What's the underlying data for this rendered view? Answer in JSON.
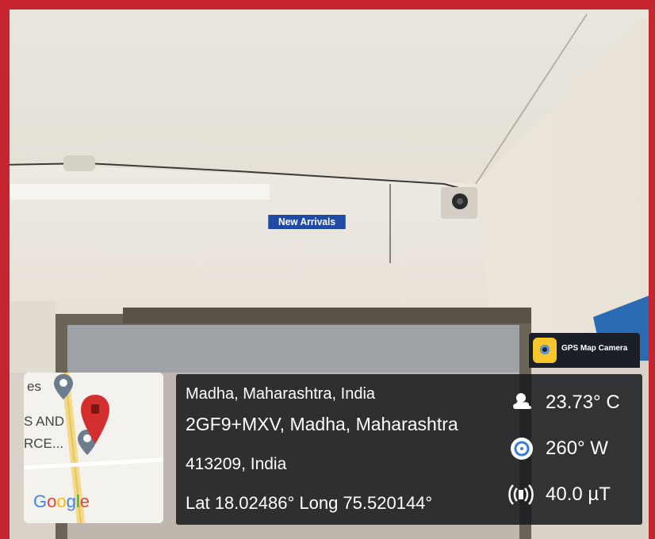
{
  "scene": {
    "sign_text": "New Arrivals"
  },
  "app_badge": {
    "label": "GPS Map Camera",
    "icon": "camera-pin-icon"
  },
  "map": {
    "labels": [
      "es",
      "S AND",
      "RCE..."
    ],
    "google_letters": [
      "G",
      "o",
      "o",
      "g",
      "l",
      "e"
    ],
    "google_colors": [
      "#4285f4",
      "#ea4335",
      "#fbbc05",
      "#4285f4",
      "#34a853",
      "#ea4335"
    ],
    "pin_color": "#d32f2f"
  },
  "location": {
    "line1": "Madha, Maharashtra, India",
    "line2": "2GF9+MXV, Madha, Maharashtra",
    "line3": "413209, India",
    "line4": "Lat 18.02486° Long 75.520144°"
  },
  "stats": {
    "temperature": "23.73° C",
    "heading": "260° W",
    "magnetic": "40.0 µT"
  },
  "colors": {
    "frame_border": "#c6252f",
    "sign_bg": "#1f4aa6"
  }
}
